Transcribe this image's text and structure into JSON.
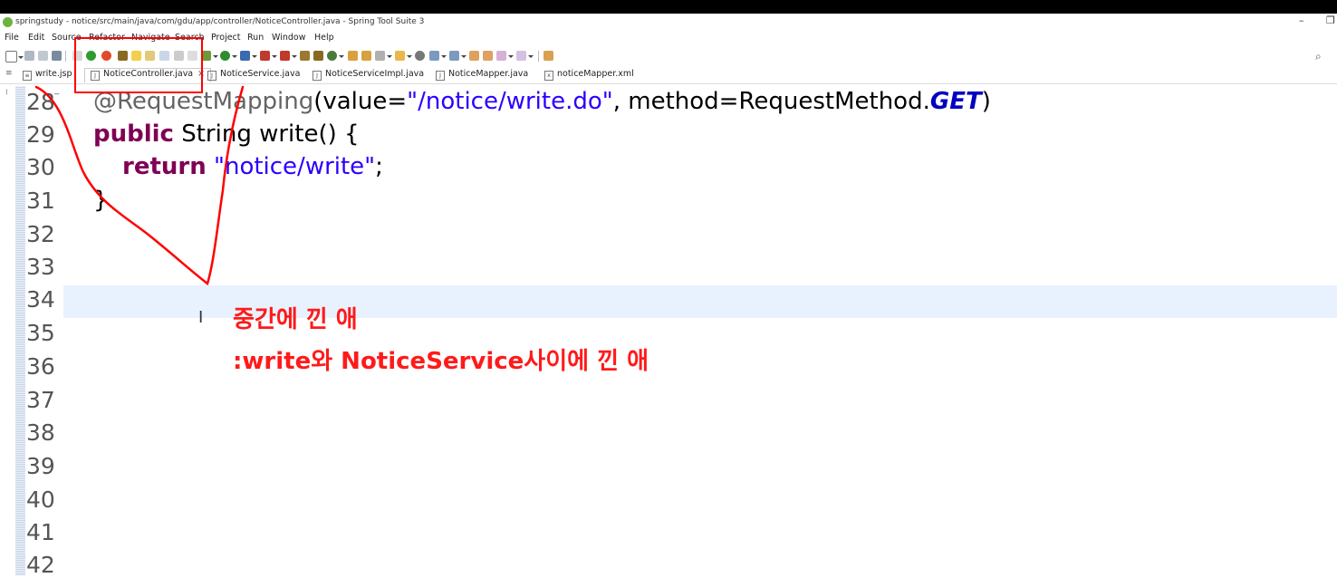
{
  "window": {
    "title": "springstudy - notice/src/main/java/com/gdu/app/controller/NoticeController.java - Spring Tool Suite 3",
    "minimize_glyph": "–",
    "restore_glyph": "❐"
  },
  "menu": [
    "File",
    "Edit",
    "Source",
    "Refactor",
    "Navigate",
    "Search",
    "Project",
    "Run",
    "Window",
    "Help"
  ],
  "tabs": [
    {
      "label": "write.jsp",
      "icon": "jsp-file-icon",
      "glyph": "≡"
    },
    {
      "label": "NoticeController.java",
      "icon": "java-file-icon",
      "glyph": "J",
      "active": true,
      "close": "×"
    },
    {
      "label": "NoticeService.java",
      "icon": "java-file-icon",
      "glyph": "J"
    },
    {
      "label": "NoticeServiceImpl.java",
      "icon": "java-file-icon",
      "glyph": "J"
    },
    {
      "label": "NoticeMapper.java",
      "icon": "java-file-icon",
      "glyph": "J"
    },
    {
      "label": "noticeMapper.xml",
      "icon": "xml-file-icon",
      "glyph": "x"
    }
  ],
  "editor": {
    "line_numbers": [
      "28",
      "29",
      "30",
      "31",
      "32",
      "33",
      "34",
      "35",
      "36",
      "37",
      "38",
      "39",
      "40",
      "41",
      "42"
    ],
    "fold_marker": "⁻",
    "code": {
      "l28_annotation": "@RequestMapping",
      "l28_p1": "(value=",
      "l28_str": "\"/notice/write.do\"",
      "l28_p2": ", method=RequestMethod.",
      "l28_get": "GET",
      "l28_p3": ")",
      "l29_kw": "public",
      "l29_rest": " String write() {",
      "l30_kw": "return",
      "l30_str": "\"notice/write\"",
      "l30_end": ";",
      "l31": "}"
    },
    "current_line": "34"
  },
  "overlay_note": {
    "line1": "중간에 낀 애",
    "line2": ":write와 NoticeService사이에 낀 애"
  },
  "colors": {
    "keyword": "#7f0055",
    "string": "#2a00ff",
    "annotation_mark": "#ff0000"
  }
}
